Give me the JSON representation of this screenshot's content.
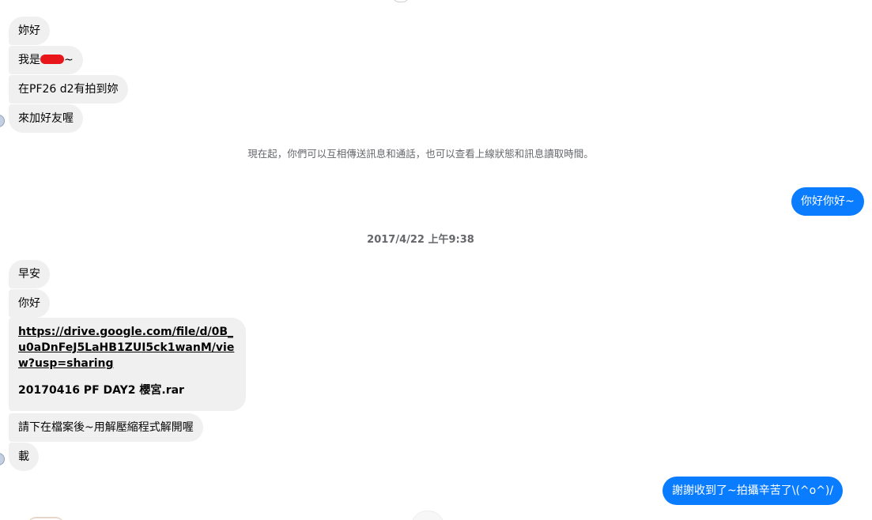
{
  "conversation": {
    "incoming_group_1": [
      {
        "text": "妳好"
      },
      {
        "text_before": "我是",
        "text_after": "~"
      },
      {
        "text": "在PF26 d2有拍到妳"
      },
      {
        "text": "來加好友喔"
      }
    ],
    "system_note": "現在起，你們可以互相傳送訊息和通話，也可以查看上線狀態和訊息讀取時間。",
    "outgoing_1": "你好你好~",
    "timestamp": "2017/4/22 上午9:38",
    "incoming_group_2": [
      {
        "text": "早安"
      },
      {
        "text": "你好"
      }
    ],
    "file_message": {
      "link": "https://drive.google.com/file/d/0B_u0aDnFeJ5LaHB1ZUI5ck1wanM/view?usp=sharing",
      "file_name": "20170416 PF DAY2 櫻宮.rar"
    },
    "incoming_group_3": [
      {
        "text": "請下在檔案後~用解壓縮程式解開喔"
      },
      {
        "text": "載"
      }
    ],
    "outgoing_2": "謝謝收到了~拍攝辛苦了\\(^o^)/"
  },
  "colors": {
    "incoming_bubble": "#f0f0f0",
    "outgoing_bubble": "#0a7cff",
    "meta_text": "#65676b",
    "redaction": "#e8151b"
  }
}
